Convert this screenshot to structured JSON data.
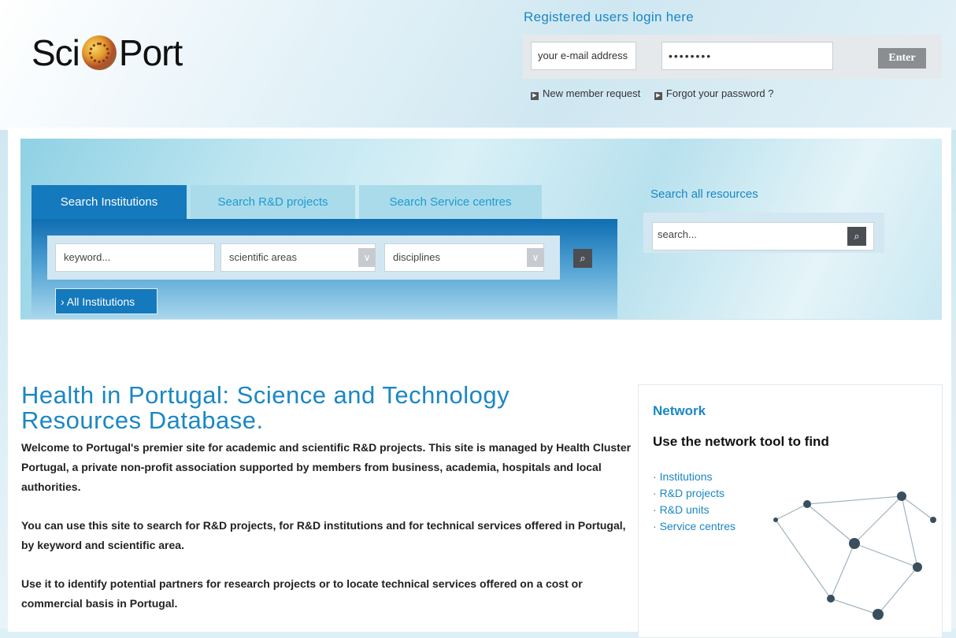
{
  "header": {
    "logo_left": "Sci",
    "logo_right": "Port",
    "login": {
      "title": "Registered users login here",
      "email_placeholder": "your e-mail address",
      "password_value": "••••••••",
      "enter_label": "Enter",
      "new_member_label": "New member request",
      "forgot_password_label": "Forgot your password ?"
    }
  },
  "search": {
    "tabs": [
      {
        "label": "Search Institutions",
        "active": true
      },
      {
        "label": "Search R&D projects",
        "active": false
      },
      {
        "label": "Search Service centres",
        "active": false
      }
    ],
    "keyword_placeholder": "keyword...",
    "scientific_areas_label": "scientific areas",
    "disciplines_label": "disciplines",
    "all_institutions_label": "› All Institutions",
    "all_resources_title": "Search all resources",
    "all_resources_placeholder": "search..."
  },
  "content": {
    "title": "Health in Portugal: Science and Technology Resources Database.",
    "paragraphs": [
      "Welcome to Portugal's premier site for academic and scientific R&D projects. This site is managed by Health Cluster Portugal, a private non-profit association supported by members from business, academia, hospitals and local authorities.",
      "You can use this site to search for R&D projects, for R&D institutions and for technical services offered in Portugal, by keyword and scientific area.",
      "Use it to identify potential partners for research projects or to locate technical services offered on a cost or commercial basis in Portugal."
    ]
  },
  "network": {
    "title": "Network",
    "subtitle": "Use the network tool to find",
    "items": [
      "Institutions",
      "R&D projects",
      "R&D units",
      "Service centres"
    ]
  },
  "colors": {
    "accent": "#1b87c4",
    "tab_active": "#1479bd",
    "tab_inactive": "#a9dbea"
  }
}
